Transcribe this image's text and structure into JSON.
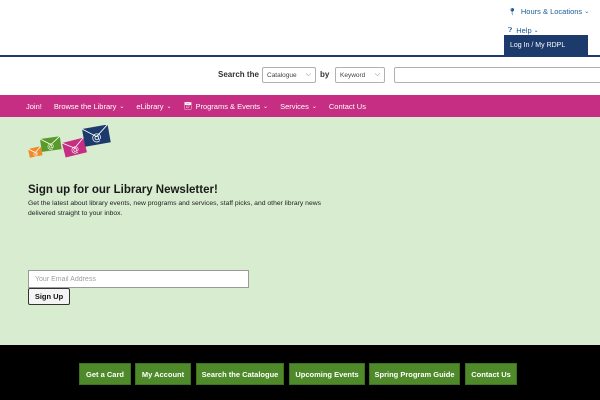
{
  "header": {
    "hours_label": "Hours & Locations",
    "help_label": "Help",
    "login_label": "Log In / My RDPL",
    "hours_icon": "map-pin-icon",
    "help_icon": "question-circle-icon"
  },
  "search": {
    "search_the_label": "Search the",
    "by_label": "by",
    "scope_value": "Catalogue",
    "type_value": "Keyword",
    "query_value": ""
  },
  "nav": {
    "items": [
      {
        "label": "Join!"
      },
      {
        "label": "Browse the Library"
      },
      {
        "label": "eLibrary"
      },
      {
        "label": "Programs & Events"
      },
      {
        "label": "Services"
      },
      {
        "label": "Contact Us"
      }
    ]
  },
  "newsletter": {
    "title": "Sign up for our Library Newsletter!",
    "description": "Get the latest about library events, new programs and services, staff picks, and other library news delivered straight to your inbox.",
    "email_placeholder": "Your Email Address",
    "signup_label": "Sign Up"
  },
  "footer": {
    "links": [
      {
        "label": "Get a Card"
      },
      {
        "label": "My Account"
      },
      {
        "label": "Search the Catalogue"
      },
      {
        "label": "Upcoming Events"
      },
      {
        "label": "Spring Program Guide"
      },
      {
        "label": "Contact Us"
      }
    ]
  },
  "colors": {
    "navy": "#1c3a6b",
    "magenta": "#c62e83",
    "light_green": "#d8ecd0",
    "footer_green": "#4f8a2a"
  }
}
